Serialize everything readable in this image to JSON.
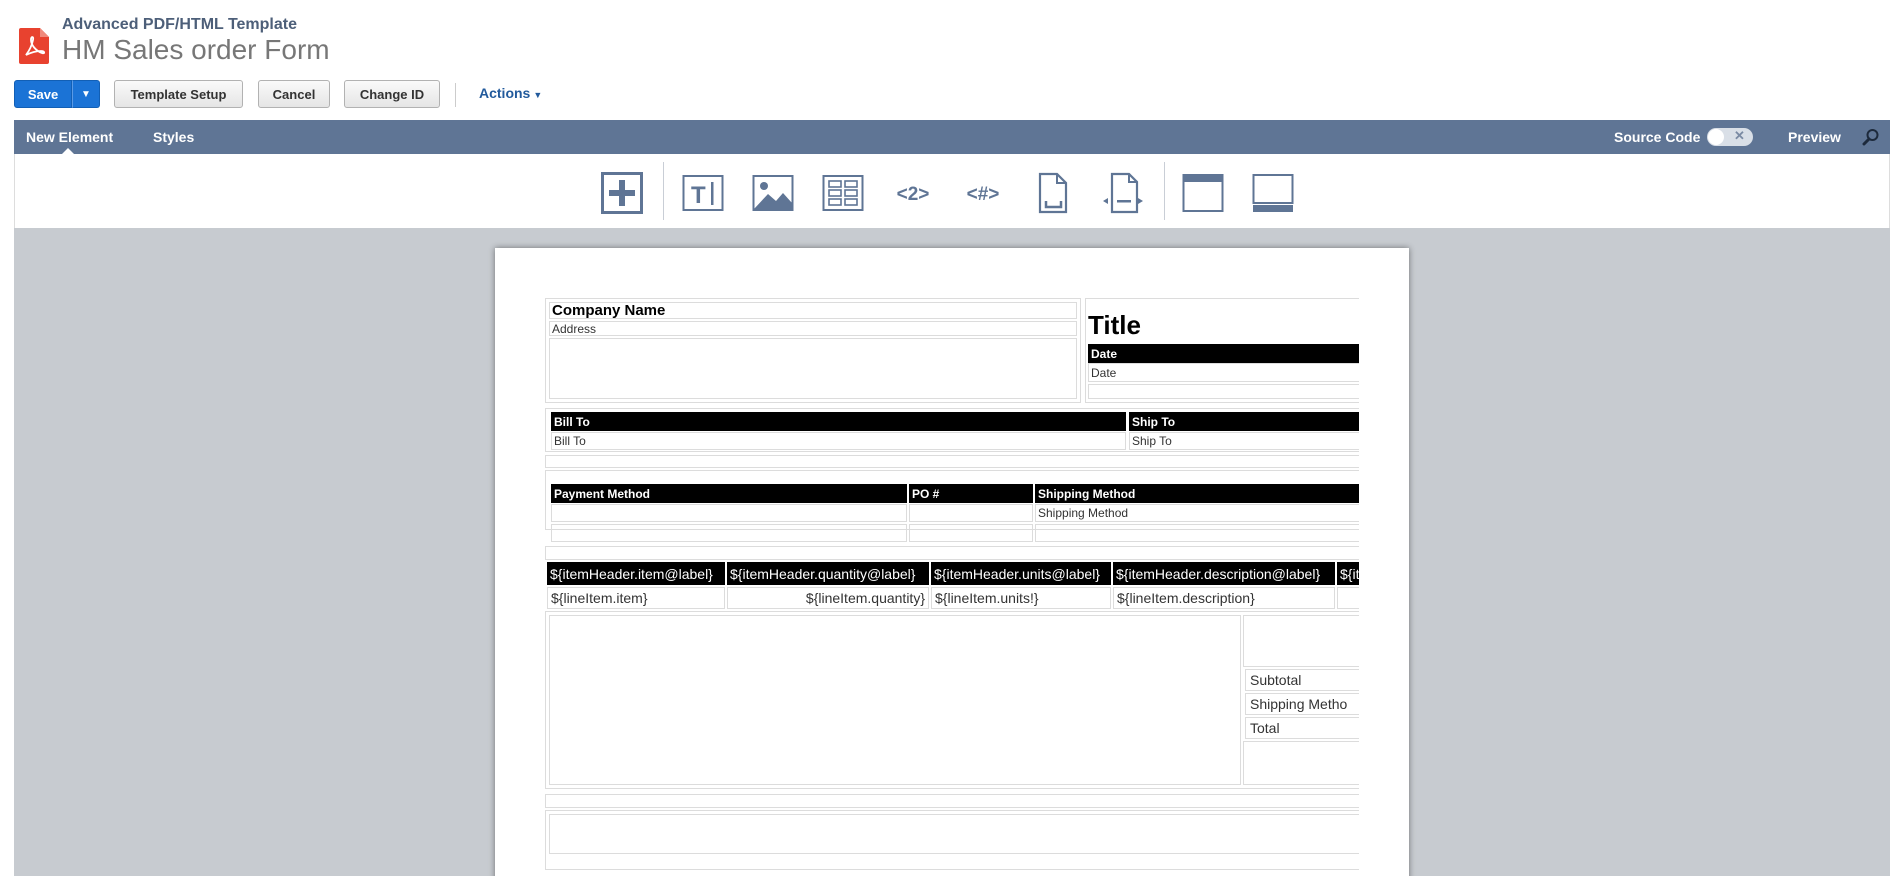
{
  "header": {
    "record_type": "Advanced PDF/HTML Template",
    "title": "HM Sales order Form"
  },
  "buttons": {
    "save": "Save",
    "template_setup": "Template Setup",
    "cancel": "Cancel",
    "change_id": "Change ID",
    "actions": "Actions"
  },
  "editor_bar": {
    "tabs": [
      "New Element",
      "Styles"
    ],
    "source_code": "Source Code",
    "preview": "Preview"
  },
  "toolbar": {
    "tools": [
      "add-element-icon",
      "text-field-icon",
      "image-icon",
      "table-icon",
      "page-number-icon",
      "total-pages-icon",
      "page-break-icon",
      "insert-page-break-icon",
      "page-header-icon",
      "page-footer-icon"
    ],
    "page_number_glyph": "<2>",
    "total_pages_glyph": "<#>"
  },
  "document": {
    "company_name": "Company Name",
    "address": "Address",
    "title": "Title",
    "date_header": "Date",
    "date_value": "Date",
    "bill_to_header": "Bill To",
    "bill_to_value": "Bill To",
    "ship_to_header": "Ship To",
    "ship_to_value": "Ship To",
    "payment_method_header": "Payment Method",
    "po_header": "PO #",
    "shipping_method_header": "Shipping Method",
    "shipping_method_value": "Shipping Method",
    "item_headers": [
      "${itemHeader.item@label}",
      "${itemHeader.quantity@label}",
      "${itemHeader.units@label}",
      "${itemHeader.description@label}",
      "${it"
    ],
    "item_cells": [
      "${lineItem.item}",
      "${lineItem.quantity}",
      "${lineItem.units!}",
      "${lineItem.description}",
      ""
    ],
    "totals": [
      "Subtotal",
      "Shipping Metho",
      "Total"
    ]
  },
  "colors": {
    "save_blue": "#1b73d6",
    "editor_bar": "#5f7595",
    "canvas_gray": "#c7cbd0",
    "icon_blue": "#5f7595",
    "pdf_red": "#e8422f"
  }
}
